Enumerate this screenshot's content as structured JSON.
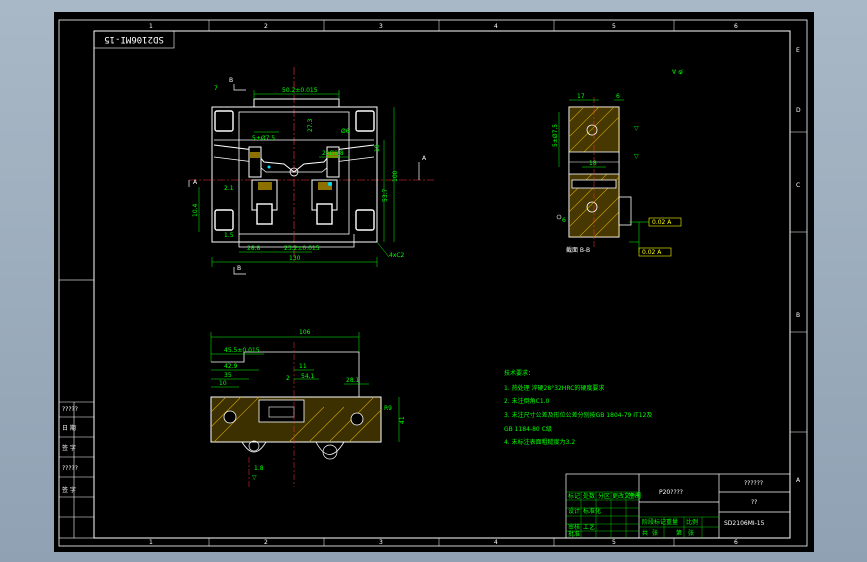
{
  "colors": {
    "background": "#000000",
    "frame": "#ffffff",
    "dimension": "#00ff00",
    "centerline": "#ff3333",
    "hatch": "#c8a000",
    "leader": "#ffff00",
    "text_block": "#00ff00",
    "titleblock_lines": "#00ff00"
  },
  "drawing_code_rotated": "SD2106MI-15",
  "top_view": {
    "section_mark_b_top": "B",
    "section_mark_b_bottom": "B",
    "section_mark_a_left": "A",
    "section_mark_a_right": "A",
    "dims": {
      "top_width": "50.2±0.015",
      "inner_small": "5±Ø7.5",
      "hole": "Ø6",
      "pitch": "2xØ8.8",
      "height_left": "10.4",
      "span_bottom_left": "28.8",
      "span_bottom_mid": "23.2±0.015",
      "overall_width": "130",
      "height_total": "100",
      "height_inner": "53.7",
      "chamfer": "4xC2",
      "side_small": "2.1",
      "v_dim_a": "27.3",
      "v_dim_b": "19",
      "bottom_small": "1.5",
      "left_small": "7"
    }
  },
  "section_view": {
    "title": "截面 B-B",
    "dims": {
      "top_width": "17",
      "right_small": "6",
      "height": "5±Ø7.5",
      "mid": "18",
      "bottom": "6",
      "tol_box_1": "0.02 A",
      "tol_box_2": "0.02 A"
    }
  },
  "bottom_view": {
    "dims": {
      "overall": "106",
      "d1": "45.5±0.015",
      "d2": "42.9",
      "d3": "35",
      "d4": "10",
      "d5": "11",
      "d6": "54.1",
      "d7": "28.1",
      "r1": "R9",
      "r2": "2",
      "h": "41",
      "bottom": "1.8"
    }
  },
  "roughness_mark": "√",
  "tech_requirements": {
    "title": "技术要求：",
    "items": [
      "1. 热处理 淬硬28°32HRC的硬度要求",
      "2. 未注倒角C1.0",
      "3. 未注尺寸公差及形位公差分别按GB 1804-79 IT12及",
      "GB 1184-80 C级",
      "4. 未标注表面粗糙度为3.2"
    ]
  },
  "title_block": {
    "part_name": "P20????",
    "material": "??????",
    "scale": "??",
    "drawing_number": "SD2106MI-15",
    "small_labels": [
      "标记",
      "处数",
      "分区",
      "更改文件号",
      "签名",
      "年月日",
      "设计",
      "标准化",
      "审核",
      "工艺",
      "批准",
      "阶段标记",
      "重量",
      "比例",
      "共",
      "张",
      "第",
      "张"
    ]
  },
  "left_strip": {
    "labels": [
      "?????",
      "日 期",
      "签 字",
      "?????",
      "签 字"
    ]
  },
  "border": {
    "top_numbers": [
      "1",
      "2",
      "3",
      "4",
      "5",
      "6"
    ],
    "right_letters": [
      "E",
      "D",
      "C",
      "B",
      "A"
    ]
  }
}
